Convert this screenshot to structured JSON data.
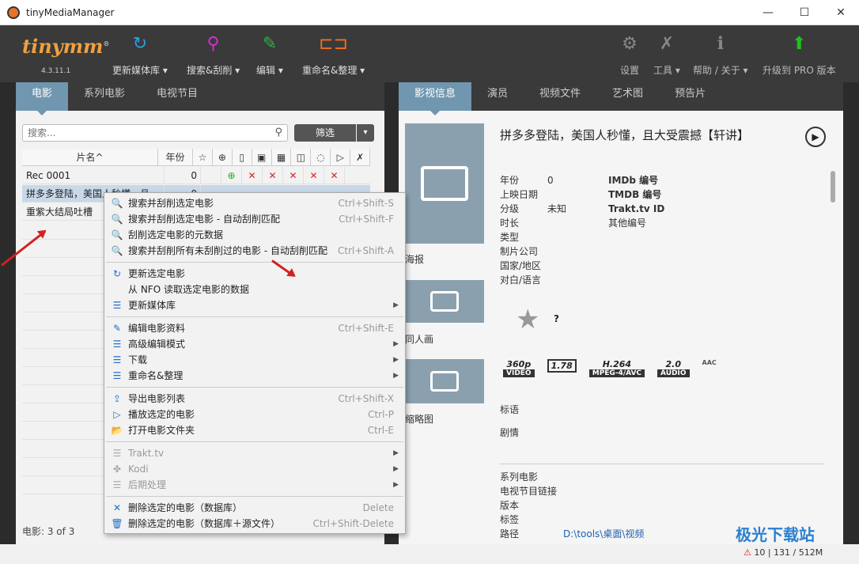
{
  "window": {
    "title": "tinyMediaManager",
    "minimize": "—",
    "maximize": "☐",
    "close": "✕"
  },
  "toolbar": {
    "logo": "tinymm",
    "logo_reg": "®",
    "version": "4.3.11.1",
    "update_library": "更新媒体库 ▾",
    "search_scrape": "搜索&刮削 ▾",
    "edit": "编辑 ▾",
    "rename": "重命名&整理 ▾",
    "settings": "设置",
    "tools": "工具 ▾",
    "help": "帮助 / 关于 ▾",
    "upgrade": "升级到 PRO 版本"
  },
  "left_tabs": [
    "电影",
    "系列电影",
    "电视节目"
  ],
  "search": {
    "placeholder": "搜索...",
    "filter": "筛选",
    "filter_arrow": "▾"
  },
  "table": {
    "col_title": "片名^",
    "col_year": "年份",
    "rows": [
      {
        "title": "Rec 0001",
        "year": "0"
      },
      {
        "title": "拼多多登陆，美国人秒懂，且",
        "year": "0"
      },
      {
        "title": "重紫大结局吐槽",
        "year": ""
      }
    ]
  },
  "status": {
    "count": "电影:  3  of  3"
  },
  "right_tabs": [
    "影视信息",
    "演员",
    "视频文件",
    "艺术图",
    "预告片"
  ],
  "detail": {
    "title": "拼多多登陆，美国人秒懂，且大受震撼【轩讲】",
    "poster": "海报",
    "fanart": "同人画",
    "thumb": "缩略图",
    "year_label": "年份",
    "year_value": "0",
    "release_label": "上映日期",
    "cert_label": "分级",
    "cert_value": "未知",
    "runtime_label": "时长",
    "genre_label": "类型",
    "studio_label": "制片公司",
    "country_label": "国家/地区",
    "lang_label": "对白/语言",
    "imdb": "IMDb 编号",
    "tmdb": "TMDB 编号",
    "trakt": "Trakt.tv ID",
    "other": "其他编号",
    "rating_q": "?",
    "res": "360p",
    "res_lbl": "VIDEO",
    "aspect": "1.78",
    "codec": "H.264",
    "codec_lbl": "MPEG-4/AVC",
    "channels": "2.0",
    "channels_lbl": "AUDIO",
    "audio_codec": "AAC",
    "tagline": "标语",
    "plot": "剧情",
    "collection": "系列电影",
    "tvshow_link": "电视节目链接",
    "edition": "版本",
    "tags": "标签",
    "path_label": "路径",
    "path_value": "D:\\tools\\桌面\\视频"
  },
  "context_menu": {
    "items": [
      {
        "icon": "🔍",
        "label": "搜索并刮削选定电影",
        "shortcut": "Ctrl+Shift-S"
      },
      {
        "icon": "🔍",
        "label": "搜索并刮削选定电影 - 自动刮削匹配",
        "shortcut": "Ctrl+Shift-F"
      },
      {
        "icon": "🔍",
        "label": "刮削选定电影的元数据",
        "shortcut": ""
      },
      {
        "icon": "🔍",
        "label": "搜索并刮削所有未刮削过的电影 - 自动刮削匹配",
        "shortcut": "Ctrl+Shift-A"
      },
      {
        "icon": "↻",
        "label": "更新选定电影",
        "shortcut": ""
      },
      {
        "icon": "",
        "label": "从 NFO 读取选定电影的数据",
        "shortcut": ""
      },
      {
        "icon": "☰",
        "label": "更新媒体库",
        "shortcut": ""
      },
      {
        "icon": "✎",
        "label": "编辑电影资料",
        "shortcut": "Ctrl+Shift-E"
      },
      {
        "icon": "☰",
        "label": "高级编辑模式",
        "shortcut": ""
      },
      {
        "icon": "☰",
        "label": "下载",
        "shortcut": ""
      },
      {
        "icon": "☰",
        "label": "重命名&整理",
        "shortcut": ""
      },
      {
        "icon": "⇪",
        "label": "导出电影列表",
        "shortcut": "Ctrl+Shift-X"
      },
      {
        "icon": "▷",
        "label": "播放选定的电影",
        "shortcut": "Ctrl-P"
      },
      {
        "icon": "📂",
        "label": "打开电影文件夹",
        "shortcut": "Ctrl-E"
      },
      {
        "icon": "☰",
        "label": "Trakt.tv",
        "shortcut": ""
      },
      {
        "icon": "✤",
        "label": "Kodi",
        "shortcut": ""
      },
      {
        "icon": "☰",
        "label": "后期处理",
        "shortcut": ""
      },
      {
        "icon": "✕",
        "label": "删除选定的电影（数据库）",
        "shortcut": "Delete"
      },
      {
        "icon": "🗑",
        "label": "删除选定的电影（数据库＋源文件）",
        "shortcut": "Ctrl+Shift-Delete"
      }
    ]
  },
  "footer": {
    "memory": "10  |  131 / 512M",
    "watermark": "极光下载站"
  }
}
